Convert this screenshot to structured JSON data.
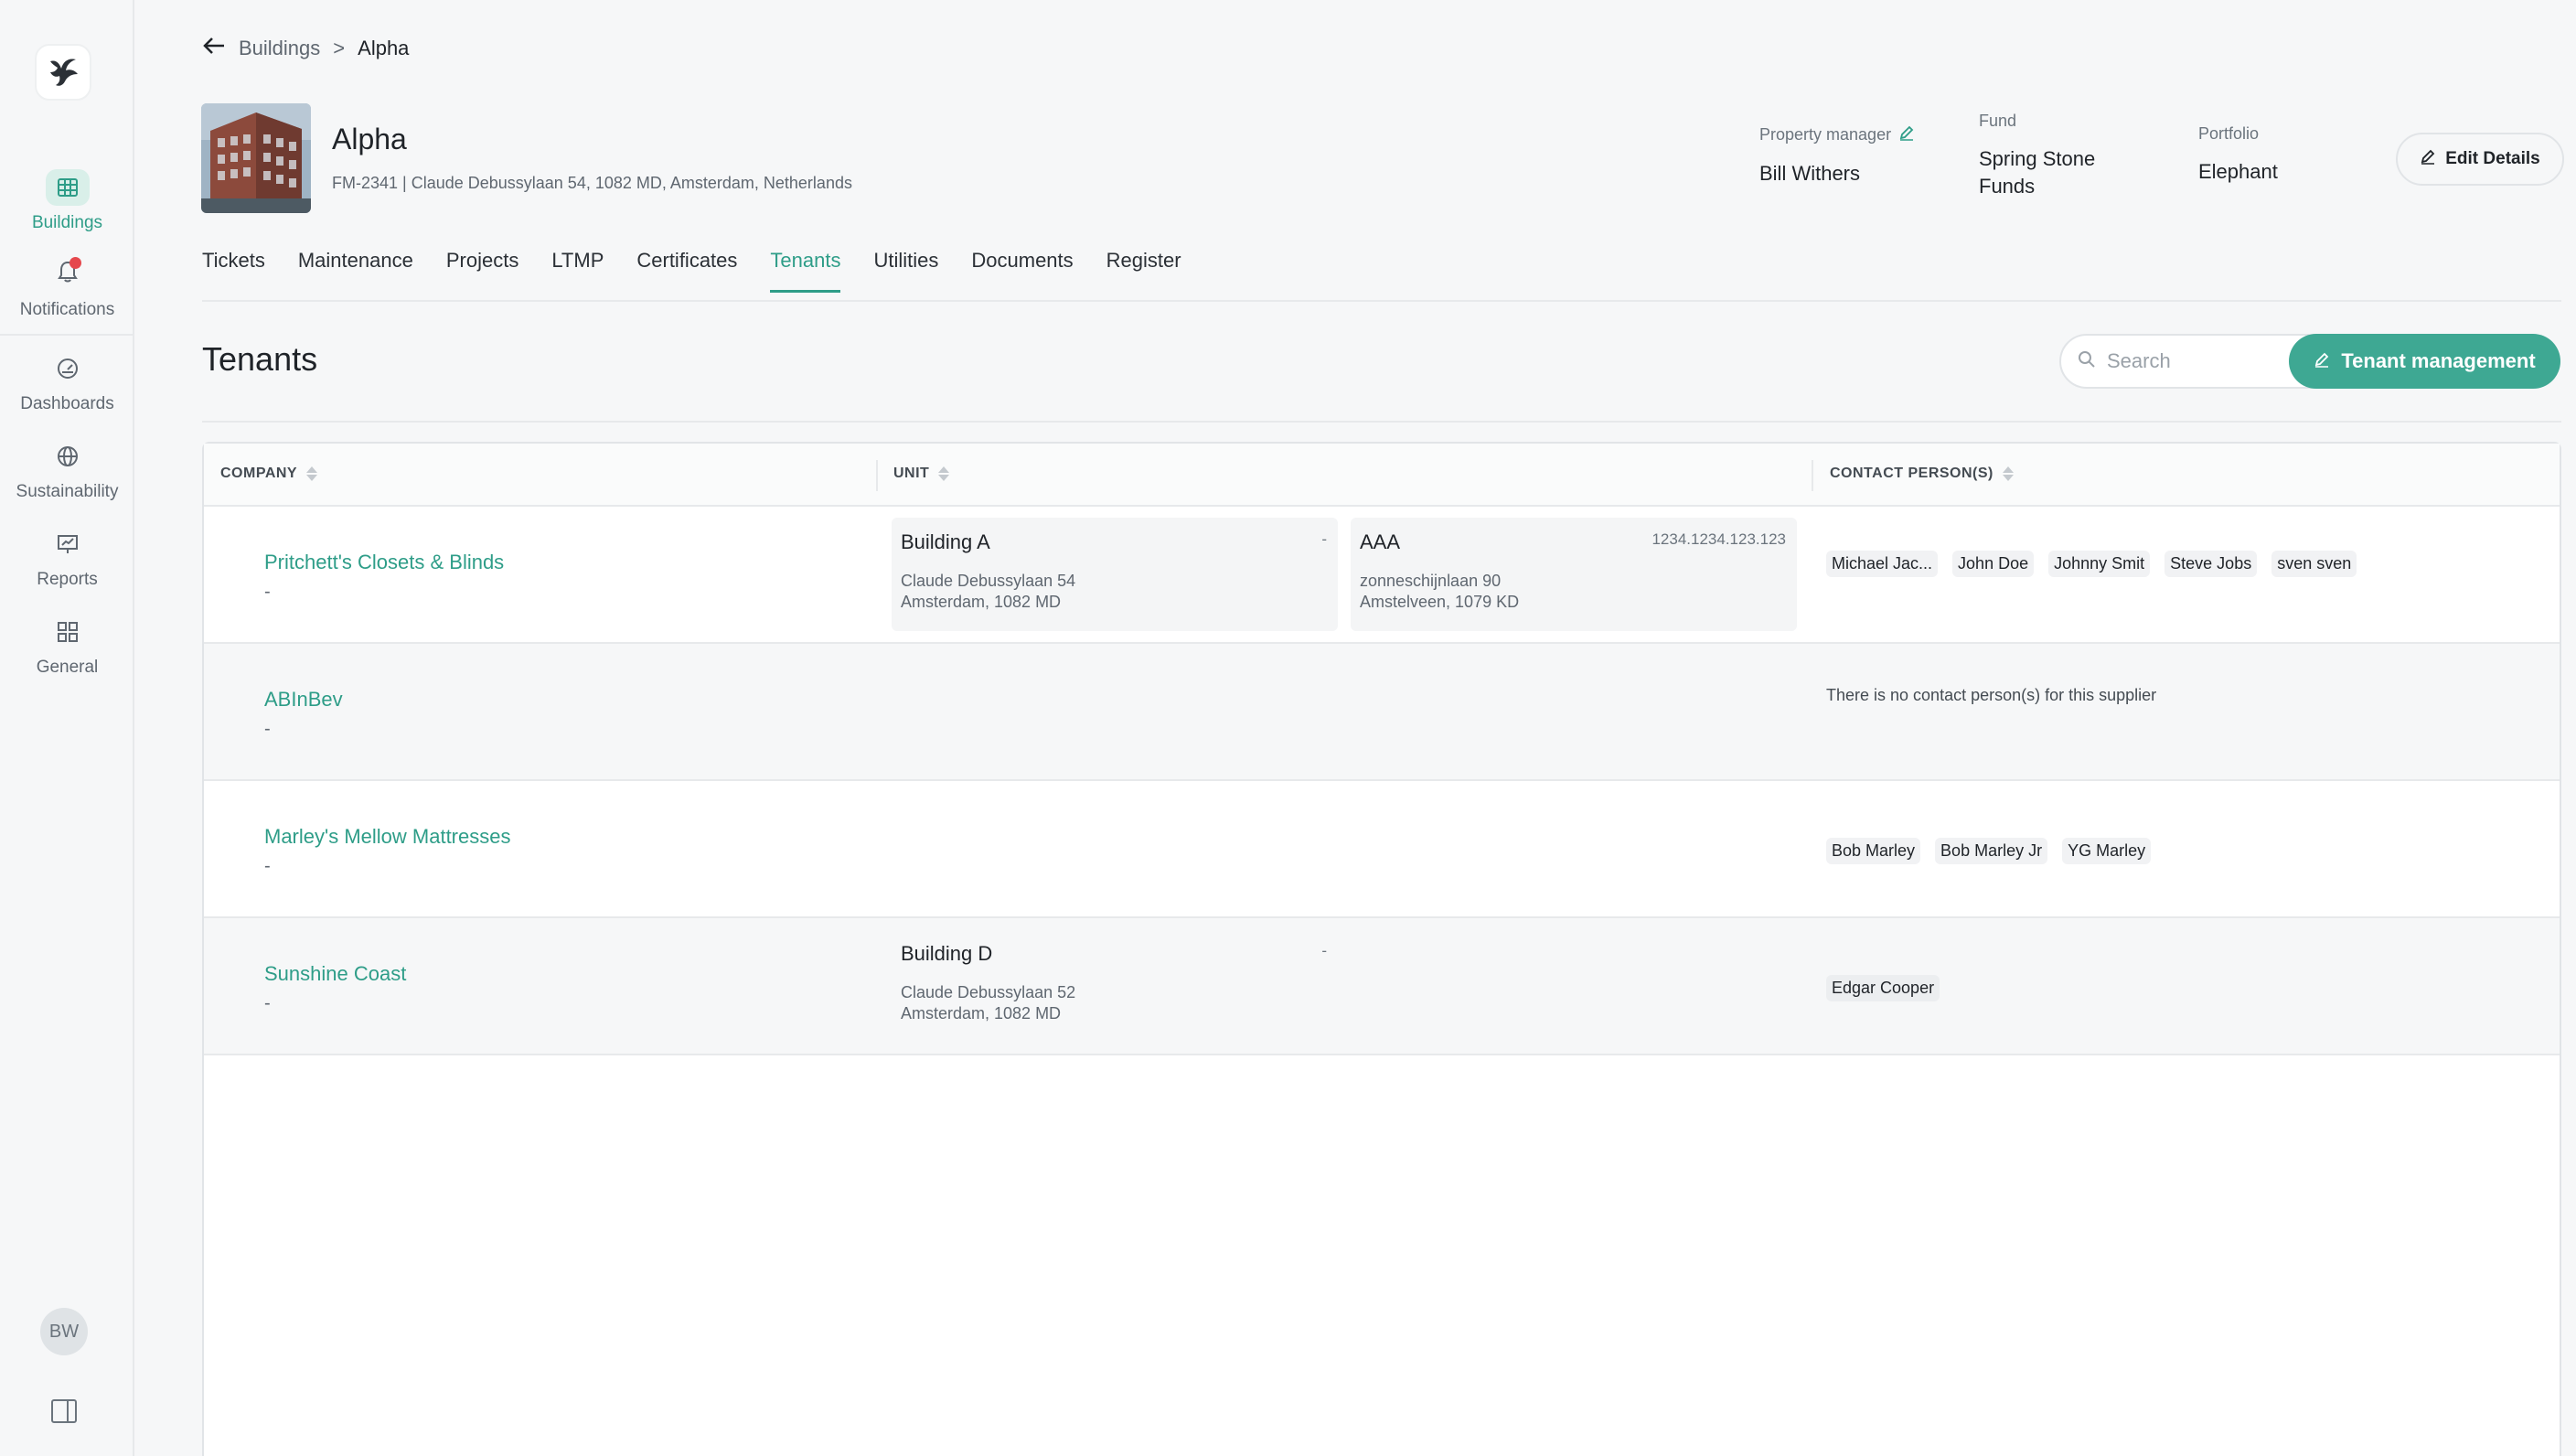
{
  "sidebar": {
    "items": [
      {
        "label": "Buildings",
        "icon": "grid-icon",
        "active": true
      },
      {
        "label": "Notifications",
        "icon": "bell-icon",
        "has_badge": true
      },
      {
        "label": "Dashboards",
        "icon": "gauge-icon"
      },
      {
        "label": "Sustainability",
        "icon": "globe-icon"
      },
      {
        "label": "Reports",
        "icon": "presentation-chart-icon"
      },
      {
        "label": "General",
        "icon": "apps-icon"
      }
    ],
    "avatar_initials": "BW"
  },
  "breadcrumb": {
    "parent": "Buildings",
    "separator": ">",
    "current": "Alpha"
  },
  "building": {
    "name": "Alpha",
    "address": "FM-2341 | Claude Debussylaan 54, 1082 MD, Amsterdam, Netherlands",
    "meta": [
      {
        "label": "Property manager",
        "value": "Bill Withers"
      },
      {
        "label": "Fund",
        "value": "Spring Stone Funds"
      },
      {
        "label": "Portfolio",
        "value": "Elephant"
      }
    ],
    "edit_label": "Edit Details"
  },
  "tabs": [
    "Tickets",
    "Maintenance",
    "Projects",
    "LTMP",
    "Certificates",
    "Tenants",
    "Utilities",
    "Documents",
    "Register"
  ],
  "active_tab": "Tenants",
  "section": {
    "title": "Tenants",
    "search_placeholder": "Search",
    "action_label": "Tenant management"
  },
  "table": {
    "headers": [
      "COMPANY",
      "UNIT",
      "CONTACT PERSON(S)"
    ],
    "rows": [
      {
        "company": "Pritchett's Closets & Blinds",
        "sub": "-",
        "units": [
          {
            "name": "Building A",
            "code": "-",
            "line1": "Claude Debussylaan 54",
            "line2": "Amsterdam, 1082 MD"
          },
          {
            "name": "AAA",
            "code": "1234.1234.123.123",
            "line1": "zonneschijnlaan 90",
            "line2": "Amstelveen, 1079 KD"
          }
        ],
        "contacts": [
          "Michael Jac...",
          "John Doe",
          "Johnny Smit",
          "Steve Jobs",
          "sven sven"
        ]
      },
      {
        "company": "ABInBev",
        "sub": "-",
        "units": [],
        "contacts": [],
        "no_contact_text": "There is no contact person(s) for this supplier"
      },
      {
        "company": "Marley's Mellow Mattresses",
        "sub": "-",
        "units": [],
        "contacts": [
          "Bob Marley",
          "Bob Marley Jr",
          "YG Marley"
        ]
      },
      {
        "company": "Sunshine Coast",
        "sub": "-",
        "units": [
          {
            "name": "Building D",
            "code": "-",
            "line1": "Claude Debussylaan 52",
            "line2": "Amsterdam, 1082 MD"
          }
        ],
        "contacts": [
          "Edgar Cooper"
        ]
      }
    ]
  },
  "colors": {
    "accent": "#2e9d88",
    "button": "#3ea893",
    "notification_dot": "#e5484d"
  }
}
